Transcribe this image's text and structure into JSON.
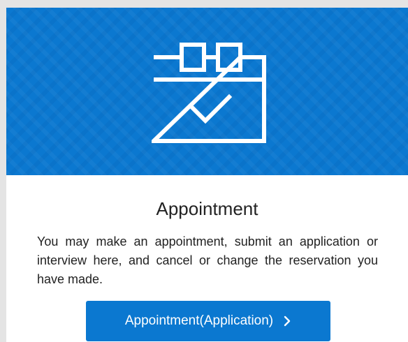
{
  "card": {
    "title": "Appointment",
    "description": "You may make an appointment, submit an application or interview here, and cancel or change the reservation you have made.",
    "banner_icon": "calendar-check-icon",
    "button": {
      "label": "Appointment(Application)",
      "icon": "chevron-right-icon"
    }
  },
  "colors": {
    "accent": "#0b78d0",
    "page_background": "#e4e4e4",
    "card_background": "#ffffff",
    "text": "#222222"
  }
}
